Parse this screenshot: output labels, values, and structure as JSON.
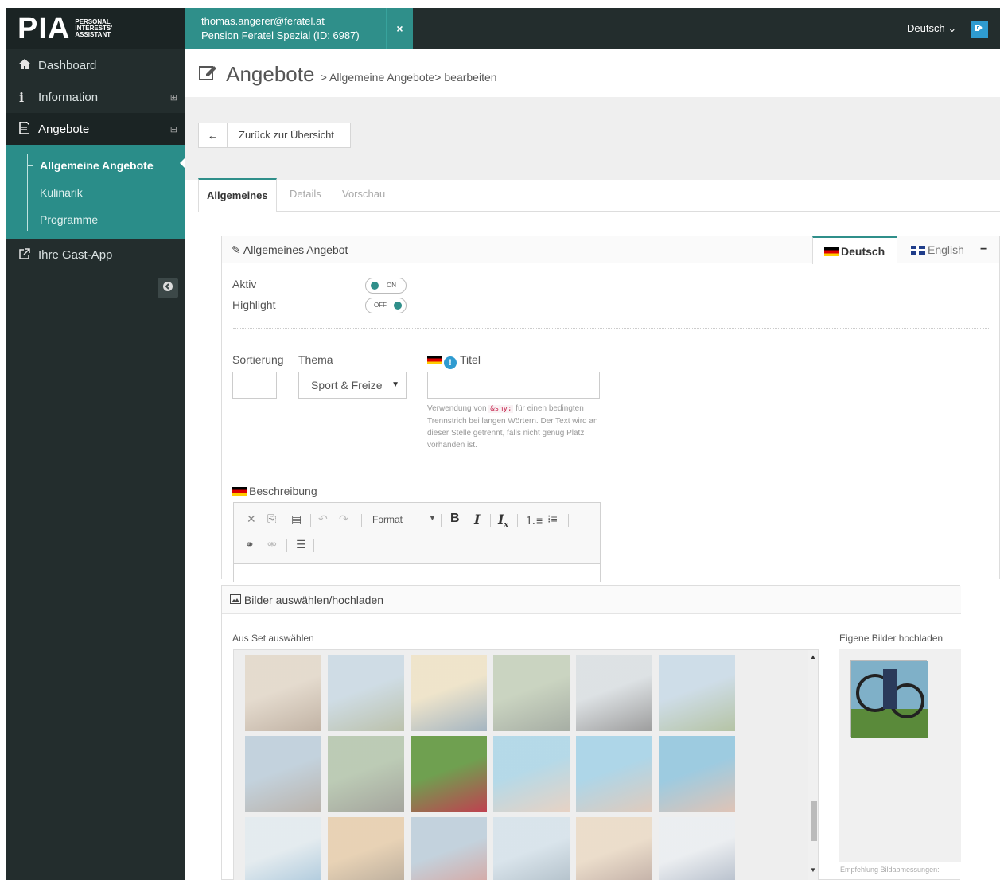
{
  "header": {
    "logo_text": "PIA",
    "logo_sub": [
      "PERSONAL",
      "INTERESTS'",
      "ASSISTANT"
    ],
    "account_email": "thomas.angerer@feratel.at",
    "account_property": "Pension Feratel Spezial (ID: 6987)",
    "close_label": "×",
    "language": "Deutsch",
    "language_caret": "⌄"
  },
  "sidebar": {
    "items": [
      {
        "label": "Dashboard",
        "icon": "home-icon"
      },
      {
        "label": "Information",
        "icon": "info-icon"
      },
      {
        "label": "Angebote",
        "icon": "document-icon"
      },
      {
        "label": "Ihre Gast-App",
        "icon": "external-link-icon"
      }
    ],
    "subitems": [
      "Allgemeine Angebote",
      "Kulinarik",
      "Programme"
    ]
  },
  "page": {
    "title": "Angebote",
    "breadcrumb": "> Allgemeine Angebote> bearbeiten",
    "back_label": "Zurück zur Übersicht",
    "tabs": [
      "Allgemeines",
      "Details",
      "Vorschau"
    ]
  },
  "panel": {
    "title": "Allgemeines Angebot",
    "languages": [
      "Deutsch",
      "English"
    ],
    "minimize": "−",
    "aktiv_label": "Aktiv",
    "aktiv_state": "ON",
    "highlight_label": "Highlight",
    "highlight_state": "OFF",
    "sortierung_label": "Sortierung",
    "thema_label": "Thema",
    "thema_value": "Sport & Freize",
    "titel_label": "Titel",
    "help_prefix": "Verwendung von",
    "help_code": "&shy;",
    "help_suffix": "für einen bedingten Trennstrich bei langen Wörtern. Der Text wird an dieser Stelle getrennt, falls nicht genug Platz vorhanden ist.",
    "beschreibung_label": "Beschreibung",
    "editor_format": "Format"
  },
  "images": {
    "title": "Bilder auswählen/hochladen",
    "from_set_label": "Aus Set auswählen",
    "upload_label": "Eigene Bilder hochladen",
    "upload_hint": "Empfehlung Bildabmessungen:",
    "thumbs": [
      {
        "name": "tennis",
        "c1": "#d9c4a8",
        "c2": "#8a6a4a",
        "faded": true
      },
      {
        "name": "hikers",
        "c1": "#a9c7da",
        "c2": "#7d8a5a",
        "faded": true
      },
      {
        "name": "sunset-path",
        "c1": "#f0d9a0",
        "c2": "#4a6f8a",
        "faded": true
      },
      {
        "name": "running-shoe",
        "c1": "#9fb58a",
        "c2": "#4f5f4a",
        "faded": true
      },
      {
        "name": "walkers",
        "c1": "#c8d2d8",
        "c2": "#3a3a3a",
        "faded": true
      },
      {
        "name": "mountain-lake",
        "c1": "#a8c8e0",
        "c2": "#6f8f4a",
        "faded": true
      },
      {
        "name": "rock-boots",
        "c1": "#8fb0c8",
        "c2": "#7a6a5a",
        "faded": true
      },
      {
        "name": "hiking-boots",
        "c1": "#7fa070",
        "c2": "#4a4a3a",
        "faded": true
      },
      {
        "name": "trail-running",
        "c1": "#6fa050",
        "c2": "#c04050",
        "faded": false
      },
      {
        "name": "pool-family",
        "c1": "#70c0e0",
        "c2": "#e0b090",
        "faded": true
      },
      {
        "name": "pool-yoga",
        "c1": "#60b8e0",
        "c2": "#d0a080",
        "faded": true
      },
      {
        "name": "swimmer",
        "c1": "#3aa0d0",
        "c2": "#d09070",
        "faded": true
      },
      {
        "name": "splash",
        "c1": "#d8e8f0",
        "c2": "#4a90c0",
        "faded": true
      },
      {
        "name": "pier",
        "c1": "#e0b070",
        "c2": "#6a5030",
        "faded": true
      },
      {
        "name": "rafting",
        "c1": "#8fb0c8",
        "c2": "#c04030",
        "faded": true
      },
      {
        "name": "lake-person",
        "c1": "#c0d8e8",
        "c2": "#5a7a90",
        "faded": true
      },
      {
        "name": "deckchair",
        "c1": "#e8c8a0",
        "c2": "#7a5040",
        "faded": true
      },
      {
        "name": "snow-mountain",
        "c1": "#e8eef4",
        "c2": "#5a7090",
        "faded": true
      }
    ]
  }
}
